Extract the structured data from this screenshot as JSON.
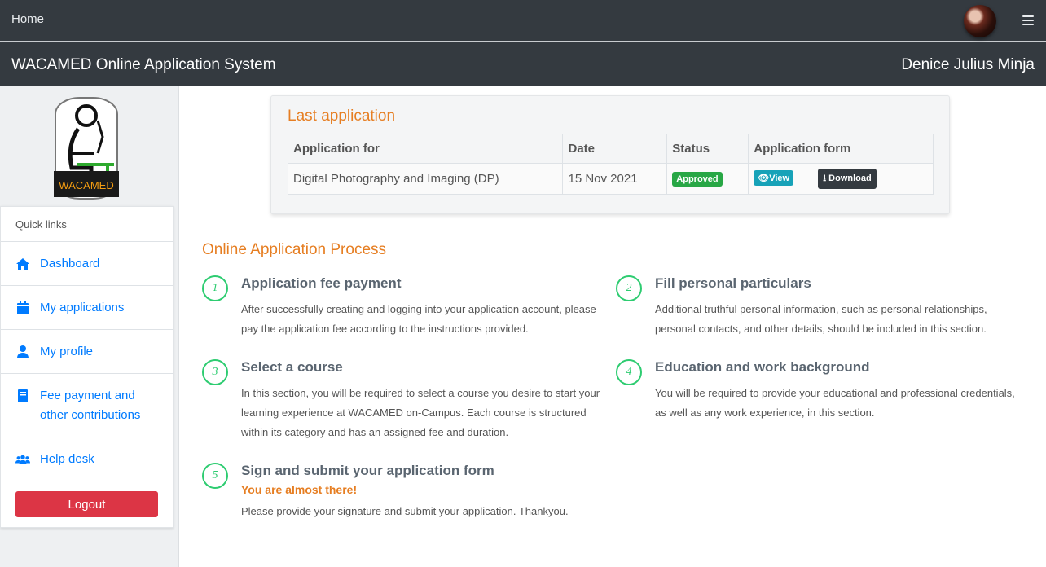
{
  "topbar": {
    "home": "Home"
  },
  "header": {
    "app_title": "WACAMED Online Application System",
    "user_name": "Denice Julius Minja"
  },
  "sidebar": {
    "logo_text": "WACAMED",
    "quick_links_title": "Quick links",
    "items": [
      {
        "label": "Dashboard",
        "icon": "home-icon"
      },
      {
        "label": "My applications",
        "icon": "calendar-icon"
      },
      {
        "label": "My profile",
        "icon": "user-icon"
      },
      {
        "label": "Fee payment and other contributions",
        "icon": "book-icon"
      },
      {
        "label": "Help desk",
        "icon": "users-icon"
      }
    ],
    "logout": "Logout"
  },
  "last_application": {
    "title": "Last application",
    "columns": [
      "Application for",
      "Date",
      "Status",
      "Application form"
    ],
    "row": {
      "application_for": "Digital Photography and Imaging (DP)",
      "date": "15 Nov 2021",
      "status": "Approved",
      "view": "View",
      "download": "Download"
    }
  },
  "process": {
    "title": "Online Application Process",
    "steps": [
      {
        "num": "1",
        "title": "Application fee payment",
        "text": "After successfully creating and logging into your application account, please pay the application fee according to the instructions provided."
      },
      {
        "num": "2",
        "title": "Fill personal particulars",
        "text": "Additional truthful personal information, such as personal relationships, personal contacts, and other details, should be included in this section."
      },
      {
        "num": "3",
        "title": "Select a course",
        "text": "In this section, you will be required to select a course you desire to start your learning experience at WACAMED on-Campus. Each course is structured within its category and has an assigned fee and duration."
      },
      {
        "num": "4",
        "title": "Education and work background",
        "text": "You will be required to provide your educational and professional credentials, as well as any work experience, in this section."
      },
      {
        "num": "5",
        "title": "Sign and submit your application form",
        "highlight": "You are almost there!",
        "text": "Please provide your signature and submit your application. Thankyou."
      }
    ]
  },
  "colors": {
    "accent": "#e67e22",
    "link": "#007bff",
    "success": "#28a745",
    "info": "#17a2b8",
    "danger": "#dc3545",
    "dark": "#343a40",
    "step_circle": "#2ecc71"
  }
}
